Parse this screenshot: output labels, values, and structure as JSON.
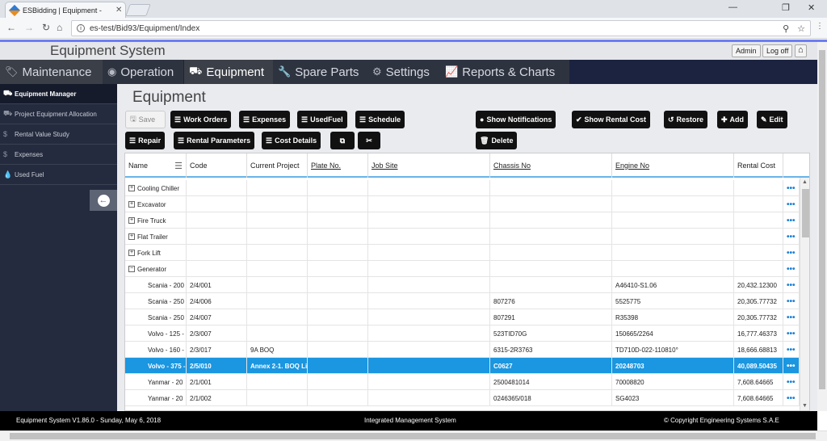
{
  "browser": {
    "tab_title": "ESBidding | Equipment -",
    "url": "es-test/Bid93/Equipment/Index"
  },
  "app": {
    "title": "Equipment System",
    "admin_label": "Admin",
    "logoff_label": "Log off"
  },
  "menu": {
    "items": [
      {
        "label": "Maintenance",
        "icon": "tags-icon"
      },
      {
        "label": "Operation",
        "icon": "target-icon"
      },
      {
        "label": "Equipment",
        "icon": "truck-icon"
      },
      {
        "label": "Spare Parts",
        "icon": "wrench-icon"
      },
      {
        "label": "Settings",
        "icon": "gear-icon"
      },
      {
        "label": "Reports & Charts",
        "icon": "chart-icon"
      }
    ]
  },
  "sidebar": {
    "items": [
      {
        "label": "Equipment Manager",
        "icon": "truck-icon"
      },
      {
        "label": "Project Equipment Allocation",
        "icon": "truck-icon"
      },
      {
        "label": "Rental Value Study",
        "icon": "dollar-icon"
      },
      {
        "label": "Expenses",
        "icon": "dollar-icon"
      },
      {
        "label": "Used Fuel",
        "icon": "drop-icon"
      }
    ]
  },
  "page": {
    "title": "Equipment"
  },
  "toolbar": {
    "save": "Save",
    "work_orders": "Work Orders",
    "expenses": "Expenses",
    "used_fuel": "UsedFuel",
    "schedule": "Schedule",
    "repair": "Repair",
    "rental_parameters": "Rental Parameters",
    "cost_details": "Cost Details",
    "show_notifications": "Show Notifications",
    "show_rental_cost": "Show Rental Cost",
    "restore": "Restore",
    "add": "Add",
    "edit": "Edit",
    "delete": "Delete"
  },
  "grid": {
    "columns": [
      "Name",
      "Code",
      "Current Project",
      "Plate No.",
      "Job Site",
      "Chassis No",
      "Engine No",
      "Rental Cost"
    ],
    "groups": [
      {
        "label": "Cooling Chiller",
        "sign": "+"
      },
      {
        "label": "Excavator",
        "sign": "+"
      },
      {
        "label": "Fire Truck",
        "sign": "+"
      },
      {
        "label": "Flat Trailer",
        "sign": "+"
      },
      {
        "label": "Fork Lift",
        "sign": "+"
      },
      {
        "label": "Generator",
        "sign": "−"
      }
    ],
    "rows": [
      {
        "name": "Scania - 200",
        "code": "2/4/001",
        "project": "",
        "plate": "",
        "site": "",
        "chassis": "",
        "engine": "A46410-S1.06",
        "cost": "20,432.12300"
      },
      {
        "name": "Scania - 250",
        "code": "2/4/006",
        "project": "",
        "plate": "",
        "site": "",
        "chassis": "807276",
        "engine": "5525775",
        "cost": "20,305.77732"
      },
      {
        "name": "Scania - 250",
        "code": "2/4/007",
        "project": "",
        "plate": "",
        "site": "",
        "chassis": "807291",
        "engine": "R35398",
        "cost": "20,305.77732"
      },
      {
        "name": "Volvo - 125 -",
        "code": "2/3/007",
        "project": "",
        "plate": "",
        "site": "",
        "chassis": "523TID70G",
        "engine": "150665/2264",
        "cost": "16,777.46373"
      },
      {
        "name": "Volvo - 160 -",
        "code": "2/3/017",
        "project": "9A BOQ",
        "plate": "",
        "site": "",
        "chassis": "6315-2R3763",
        "engine": "TD710D-022-110810°",
        "cost": "18,666.68813"
      },
      {
        "name": "Volvo - 375 -",
        "code": "2/5/010",
        "project": "Annex 2-1. BOQ Li",
        "plate": "",
        "site": "",
        "chassis": "C0627",
        "engine": "20248703",
        "cost": "40,089.50435",
        "selected": true
      },
      {
        "name": "Yanmar - 20",
        "code": "2/1/001",
        "project": "",
        "plate": "",
        "site": "",
        "chassis": "2500481014",
        "engine": "70008820",
        "cost": "7,608.64665"
      },
      {
        "name": "Yanmar - 20",
        "code": "2/1/002",
        "project": "",
        "plate": "",
        "site": "",
        "chassis": "0246365/018",
        "engine": "SG4023",
        "cost": "7,608.64665"
      }
    ],
    "more_symbol": "•••"
  },
  "footer": {
    "version": "Equipment System V1.86.0 - Sunday, May 6, 2018",
    "center": "Integrated Management System",
    "copyright": "© Copyright Engineering Systems S.A.E"
  }
}
